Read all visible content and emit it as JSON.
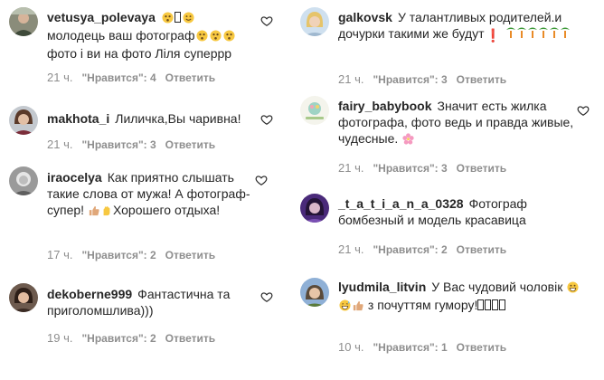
{
  "left": [
    {
      "username": "vetusya_polevaya",
      "text_parts": [
        "",
        "молодець ваш фотограф",
        "фото і ви на фото Ліля суперрр"
      ],
      "time": "21 ч.",
      "likes": "\"Нравится\": 4",
      "reply": "Ответить"
    },
    {
      "username": "makhota_i",
      "text": "Лиличка,Вы чаривна!",
      "time": "21 ч.",
      "likes": "\"Нравится\": 3",
      "reply": "Ответить"
    },
    {
      "username": "iraocelya",
      "text_parts": [
        "Как приятно слышать такие слова от мужа! А фотограф-супер!",
        "Хорошего отдыха!"
      ],
      "time": "17 ч.",
      "likes": "\"Нравится\": 2",
      "reply": "Ответить"
    },
    {
      "username": "dekoberne999",
      "text": "Фантастична та приголомшлива)))",
      "time": "19 ч.",
      "likes": "\"Нравится\": 2",
      "reply": "Ответить"
    }
  ],
  "right": [
    {
      "username": "galkovsk",
      "text": "У талантливых родителей.и дочурки такими же будут",
      "time": "21 ч.",
      "likes": "\"Нравится\": 3",
      "reply": "Ответить"
    },
    {
      "username": "fairy_babybook",
      "text": "Значит есть жилка фотографа, фото ведь и правда живые, чудесные.",
      "time": "21 ч.",
      "likes": "\"Нравится\": 3",
      "reply": "Ответить"
    },
    {
      "username": "_t_a_t_i_a_n_a_0328",
      "text": "Фотограф бомбезный и модель красавица",
      "time": "21 ч.",
      "likes": "\"Нравится\": 2",
      "reply": "Ответить"
    },
    {
      "username": "lyudmila_litvin",
      "text_parts": [
        "У Вас чудовий чоловік",
        "з почуттям гумору!"
      ],
      "time": "10 ч.",
      "likes": "\"Нравится\": 1",
      "reply": "Ответить"
    }
  ],
  "colors": {
    "text": "#262626",
    "meta": "#8e8e8e",
    "heart": "#262626"
  }
}
